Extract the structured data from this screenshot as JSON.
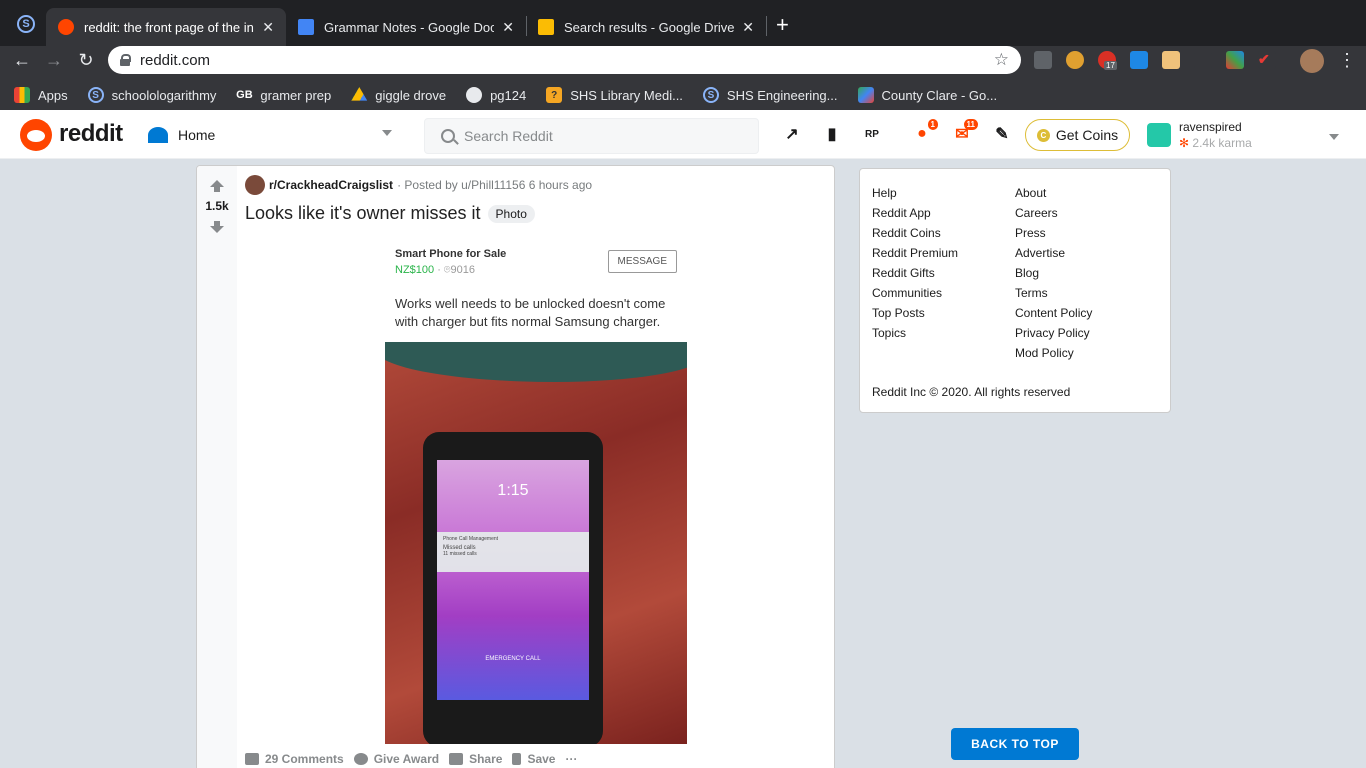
{
  "browser": {
    "tabs": [
      {
        "title": "reddit: the front page of the int",
        "favicon_color": "#ff4500",
        "active": true
      },
      {
        "title": "Grammar Notes - Google Docs",
        "favicon_color": "#4285f4",
        "active": false
      },
      {
        "title": "Search results - Google Drive",
        "favicon_color": "#fbbc04",
        "active": false
      }
    ],
    "close_glyph": "✕",
    "newtab_glyph": "+",
    "url": "reddit.com",
    "ext_badge_count": "17",
    "bookmarks": [
      {
        "label": "Apps",
        "icon": "apps-grid-icon"
      },
      {
        "label": "schoolologarithmy",
        "icon": "schoology-icon"
      },
      {
        "label": "gramer prep",
        "icon": "gb-icon"
      },
      {
        "label": "giggle drove",
        "icon": "drive-icon"
      },
      {
        "label": "pg124",
        "icon": "globe-icon"
      },
      {
        "label": "SHS Library Medi...",
        "icon": "library-icon"
      },
      {
        "label": "SHS Engineering...",
        "icon": "schoology-icon"
      },
      {
        "label": "County Clare - Go...",
        "icon": "maps-icon"
      }
    ]
  },
  "reddit": {
    "wordmark": "reddit",
    "feed_selector": "Home",
    "search_placeholder": "Search Reddit",
    "chat_count": "1",
    "inbox_count": "11",
    "coins_label": "Get Coins",
    "username": "ravenspired",
    "karma": "2.4k karma",
    "colors": {
      "brand": "#ff4500",
      "blue": "#0079d3",
      "coin": "#ddbd37",
      "background": "#dae0e6"
    }
  },
  "post": {
    "score": "1.5k",
    "subreddit": "r/CrackheadCraigslist",
    "posted_by": "· Posted by u/Phill11156 6 hours ago",
    "title": "Looks like it's owner misses it",
    "flair": "Photo",
    "listing": {
      "title": "Smart Phone for Sale",
      "price": "NZ$100",
      "location": "9016",
      "message_button": "MESSAGE",
      "description": "Works well needs to be unlocked doesn't come with charger but fits normal Samsung charger."
    },
    "phone_screen": {
      "time": "1:15",
      "notification_app": "Phone Call Management",
      "notification_title": "Missed calls",
      "notification_body": "11 missed calls",
      "emergency": "EMERGENCY CALL"
    },
    "actions": {
      "comments": "29 Comments",
      "award": "Give Award",
      "share": "Share",
      "save": "Save",
      "more": "···"
    }
  },
  "sidebar": {
    "col1": [
      "Help",
      "Reddit App",
      "Reddit Coins",
      "Reddit Premium",
      "Reddit Gifts",
      "Communities",
      "Top Posts",
      "Topics"
    ],
    "col2": [
      "About",
      "Careers",
      "Press",
      "Advertise",
      "Blog",
      "Terms",
      "Content Policy",
      "Privacy Policy",
      "Mod Policy"
    ],
    "copyright": "Reddit Inc © 2020. All rights reserved",
    "back_to_top": "BACK TO TOP"
  }
}
